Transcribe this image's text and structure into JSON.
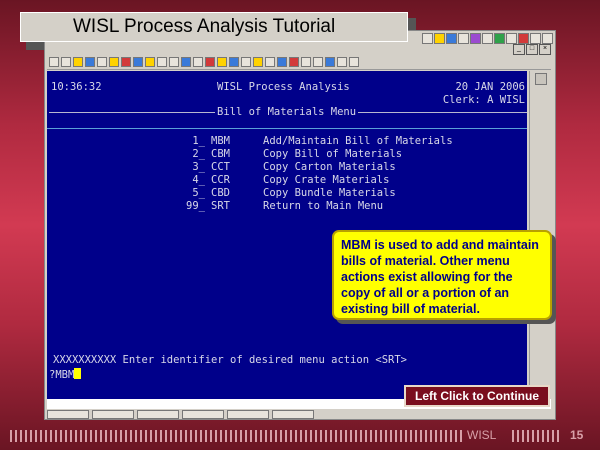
{
  "slide": {
    "title": "WISL Process Analysis Tutorial",
    "footer_label": "WISL",
    "page_number": "15",
    "continue_label": "Left Click to Continue"
  },
  "terminal": {
    "time": "10:36:32",
    "app_title": "WISL Process Analysis",
    "date": "20 JAN 2006",
    "clerk": "Clerk: A WISL",
    "menu_title": "Bill of Materials Menu",
    "menu_items": [
      {
        "num": "1_",
        "code": "MBM",
        "label": "Add/Maintain Bill of Materials"
      },
      {
        "num": "2_",
        "code": "CBM",
        "label": "Copy Bill of Materials"
      },
      {
        "num": "3_",
        "code": "CCT",
        "label": "Copy Carton Materials"
      },
      {
        "num": "4_",
        "code": "CCR",
        "label": "Copy Crate Materials"
      },
      {
        "num": "5_",
        "code": "CBD",
        "label": "Copy Bundle Materials"
      },
      {
        "num": "99_",
        "code": "SRT",
        "label": "Return to Main Menu"
      }
    ],
    "prompt": "XXXXXXXXXX Enter identifier of desired menu action <SRT>",
    "command": "?MBM"
  },
  "callout": {
    "text": "MBM is used to add and maintain bills of material. Other menu actions exist allowing for the copy of all or a portion of an existing bill of material."
  },
  "colors": {
    "terminal_bg": "#00008a",
    "callout_bg": "#ffff00",
    "callout_text": "#00008a",
    "continue_bg": "#7a0e1e"
  }
}
